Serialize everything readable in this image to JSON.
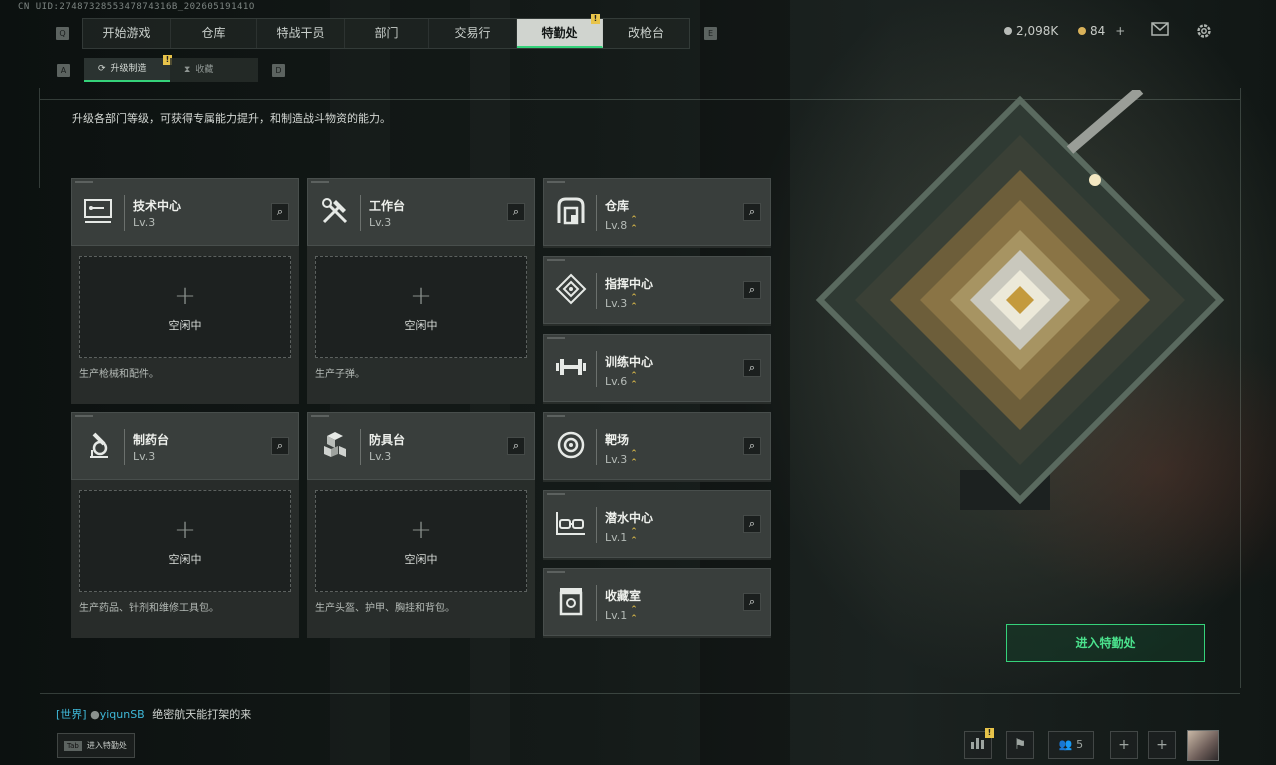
{
  "uid": "CN UID:2748732855347874316B_20260519141O",
  "nav": {
    "left_key": "Q",
    "right_key": "E",
    "tabs": [
      {
        "label": "开始游戏"
      },
      {
        "label": "仓库"
      },
      {
        "label": "特战干员"
      },
      {
        "label": "部门"
      },
      {
        "label": "交易行"
      },
      {
        "label": "特勤处",
        "active": true,
        "badge": "!"
      },
      {
        "label": "改枪台"
      }
    ]
  },
  "currency": {
    "coins": "2,098K",
    "tokens": "84",
    "tokens_add": "+",
    "coin_color": "#b8bcb8",
    "token_color": "#d9b25a"
  },
  "subtabs": {
    "left_key": "A",
    "right_key": "D",
    "items": [
      {
        "label": "升级制造",
        "active": true,
        "badge": "!"
      },
      {
        "label": "收藏"
      }
    ]
  },
  "description": "升级各部门等级，可获得专属能力提升，和制造战斗物资的能力。",
  "workbenches": [
    {
      "name": "技术中心",
      "level": "Lv.3",
      "icon": "tech-center-icon",
      "slot_label": "空闲中",
      "note": "生产枪械和配件。"
    },
    {
      "name": "工作台",
      "level": "Lv.3",
      "icon": "workbench-icon",
      "slot_label": "空闲中",
      "note": "生产子弹。"
    },
    {
      "name": "制药台",
      "level": "Lv.3",
      "icon": "pharmacy-icon",
      "slot_label": "空闲中",
      "note": "生产药品、针剂和维修工具包。"
    },
    {
      "name": "防具台",
      "level": "Lv.3",
      "icon": "armor-bench-icon",
      "slot_label": "空闲中",
      "note": "生产头盔、护甲、胸挂和背包。"
    }
  ],
  "departments": [
    {
      "name": "仓库",
      "level": "Lv.8",
      "icon": "warehouse-icon"
    },
    {
      "name": "指挥中心",
      "level": "Lv.3",
      "icon": "command-center-icon"
    },
    {
      "name": "训练中心",
      "level": "Lv.6",
      "icon": "training-center-icon"
    },
    {
      "name": "靶场",
      "level": "Lv.3",
      "icon": "shooting-range-icon"
    },
    {
      "name": "潜水中心",
      "level": "Lv.1",
      "icon": "diving-center-icon"
    },
    {
      "name": "收藏室",
      "level": "Lv.1",
      "icon": "collection-room-icon"
    }
  ],
  "enter_button": "进入特勤处",
  "chat": {
    "channel": "[世界]",
    "user": "yiqunSB",
    "message": "绝密航天能打架的来"
  },
  "tab_hint": {
    "key": "Tab",
    "label": "进入特勤处"
  },
  "bottom_bar": {
    "friends_count": "5",
    "stats_badge": "!"
  },
  "accent_color": "#35d27a",
  "badge_color": "#e8c44a"
}
